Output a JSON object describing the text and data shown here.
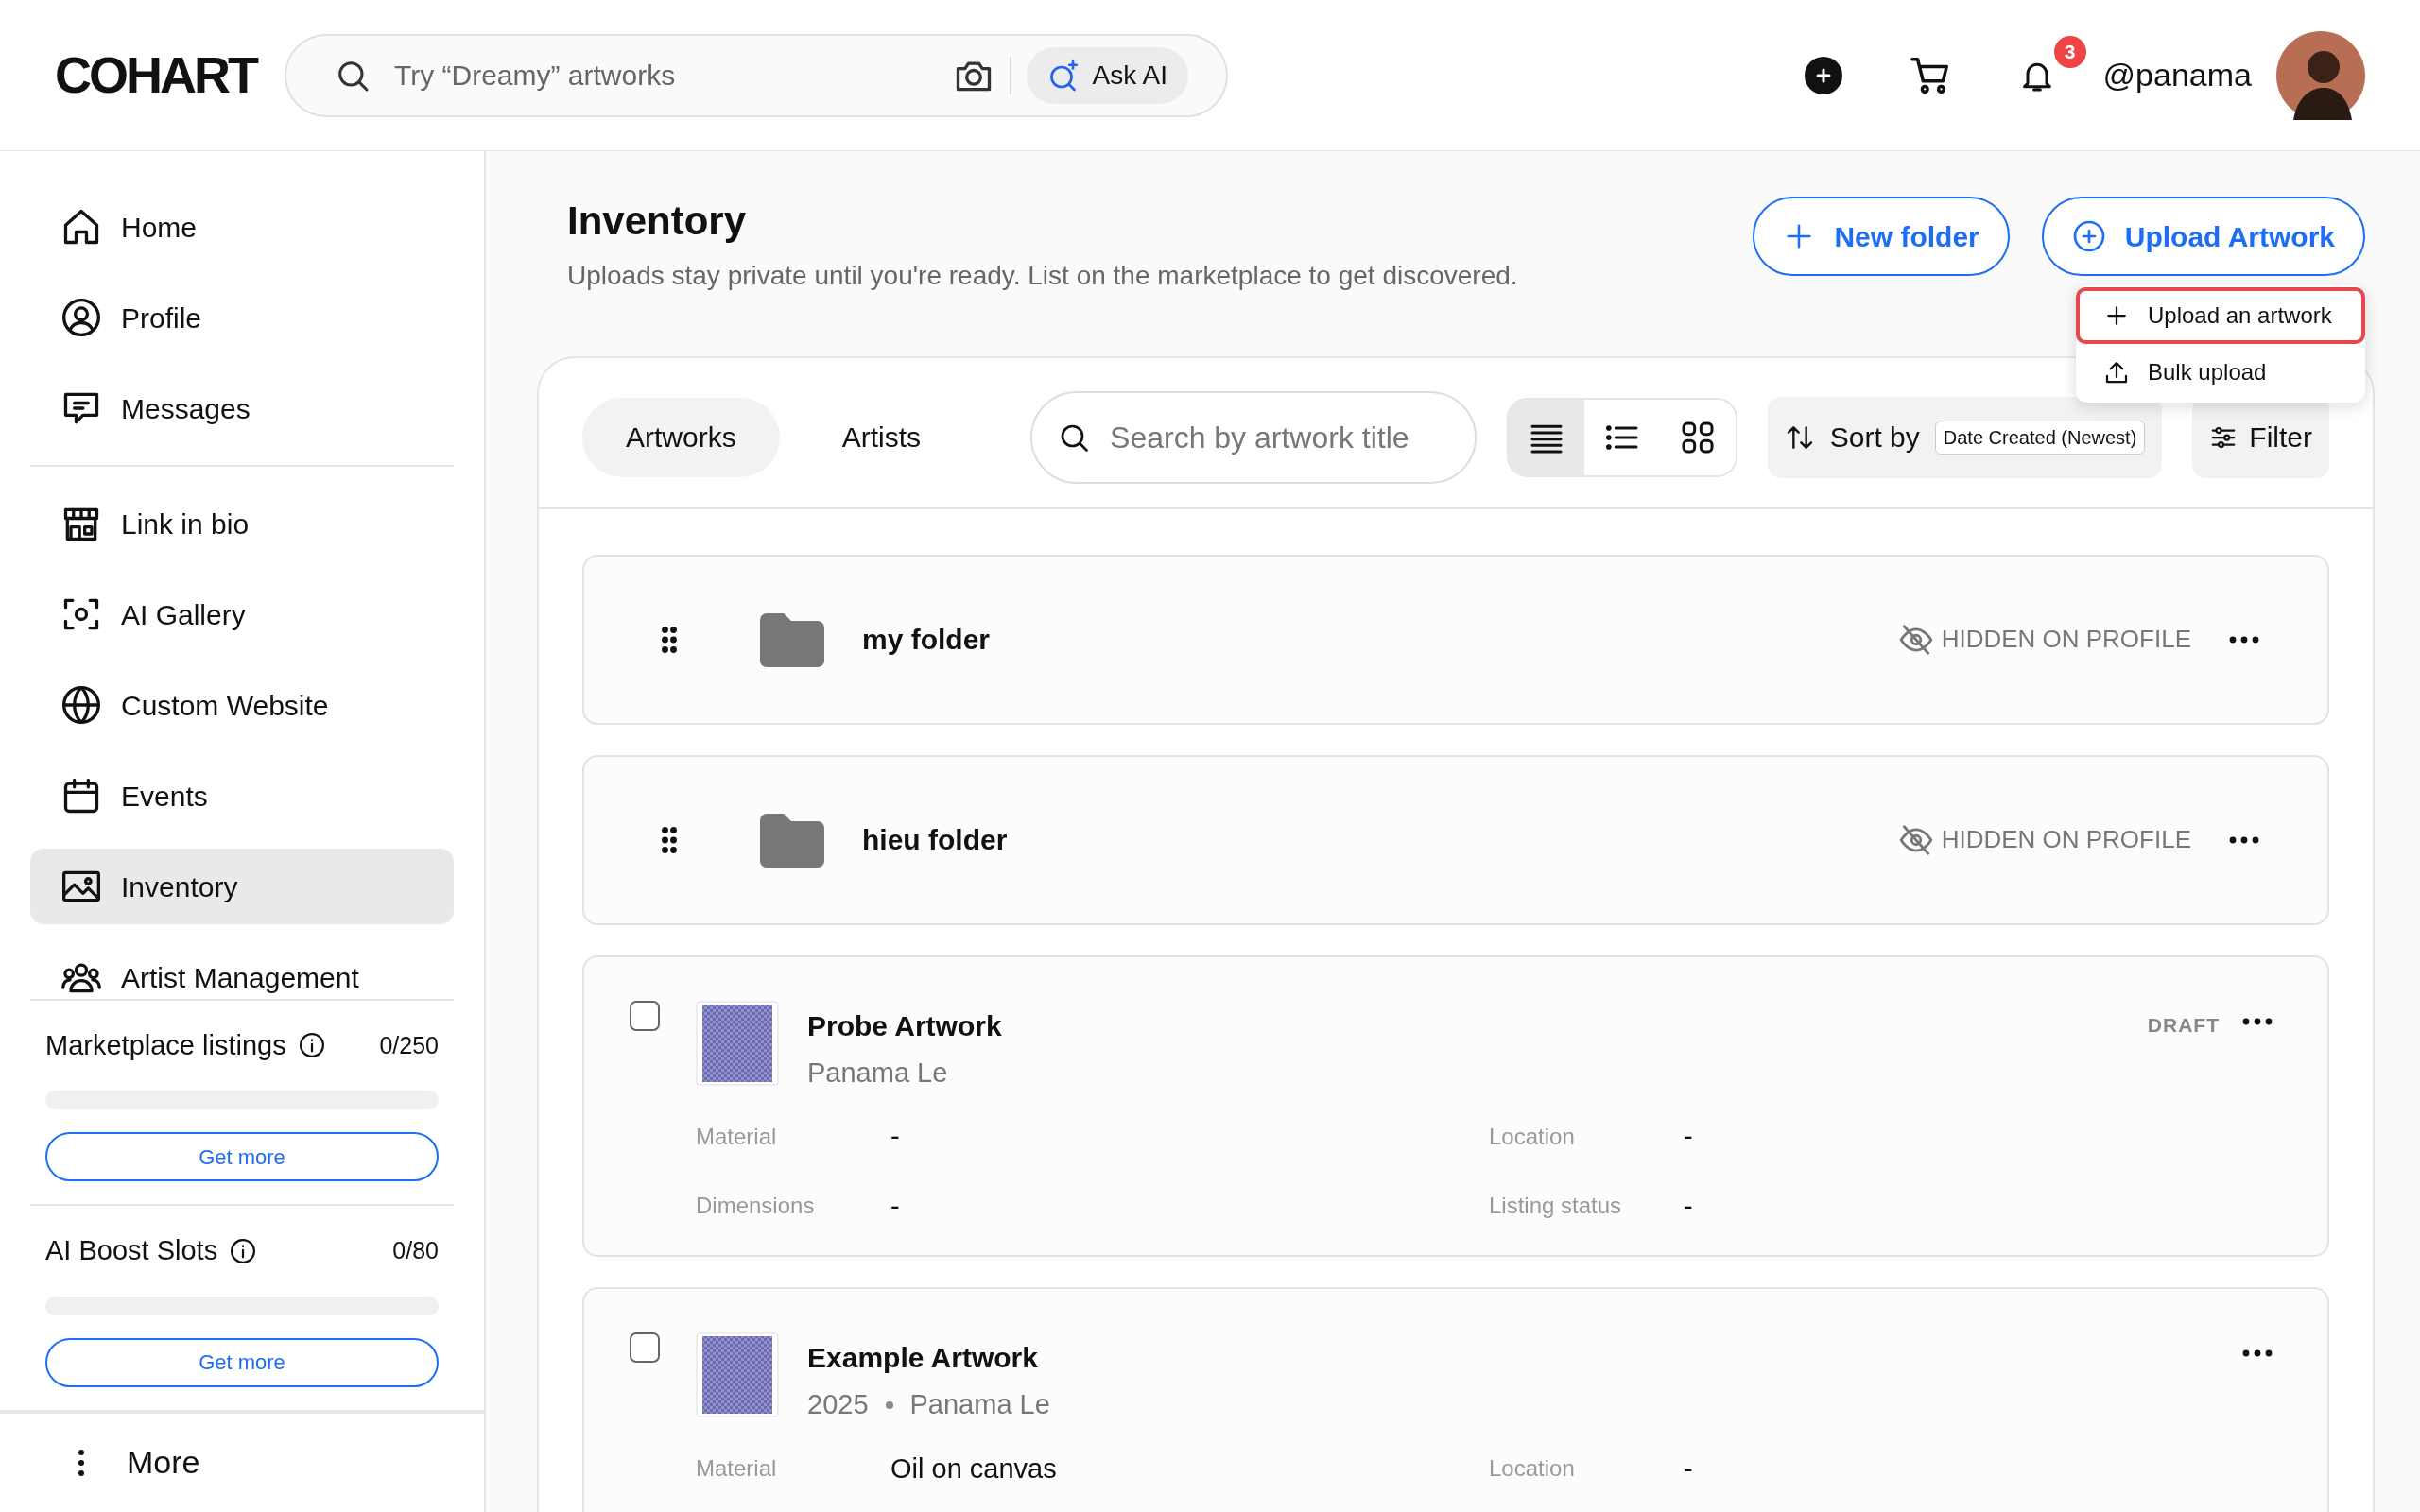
{
  "header": {
    "logo": "COHART",
    "search": {
      "placeholder": "Try “Dreamy” artworks"
    },
    "ask_ai": "Ask AI",
    "notification_count": "3",
    "username": "@panama"
  },
  "sidebar": {
    "groups": [
      [
        {
          "kind": "home",
          "label": "Home",
          "selected": false
        },
        {
          "kind": "profile",
          "label": "Profile",
          "selected": false
        },
        {
          "kind": "messages",
          "label": "Messages",
          "selected": false
        }
      ],
      [
        {
          "kind": "store",
          "label": "Link in bio",
          "selected": false
        },
        {
          "kind": "scan",
          "label": "AI Gallery",
          "selected": false
        },
        {
          "kind": "globe",
          "label": "Custom Website",
          "selected": false
        },
        {
          "kind": "calendar",
          "label": "Events",
          "selected": false
        },
        {
          "kind": "image",
          "label": "Inventory",
          "selected": true
        },
        {
          "kind": "people",
          "label": "Artist Management",
          "selected": false
        }
      ]
    ],
    "quotas": [
      {
        "label": "Marketplace listings",
        "count": "0/250",
        "level": 0,
        "button": "Get more"
      },
      {
        "label": "AI Boost Slots",
        "count": "0/80",
        "level": 0,
        "button": "Get more"
      }
    ],
    "more": "More"
  },
  "main": {
    "title": "Inventory",
    "subtitle": "Uploads stay private until you're ready. List on the marketplace to get discovered.",
    "buttons": [
      {
        "kind": "plus",
        "label": "New folder"
      },
      {
        "kind": "plus-circle",
        "label": "Upload Artwork"
      }
    ],
    "upload_menu": [
      {
        "kind": "plus",
        "label": "Upload an artwork",
        "highlighted": true
      },
      {
        "kind": "upload",
        "label": "Bulk upload",
        "highlighted": false
      }
    ],
    "tabs": [
      {
        "label": "Artworks",
        "selected": true
      },
      {
        "label": "Artists",
        "selected": false
      }
    ],
    "search": {
      "placeholder": "Search by artwork title"
    },
    "views": [
      {
        "kind": "rows",
        "selected": true
      },
      {
        "kind": "list",
        "selected": false
      },
      {
        "kind": "grid",
        "selected": false
      }
    ],
    "sort": {
      "label": "Sort by",
      "value": "Date Created (Newest)"
    },
    "filter": "Filter",
    "folders": [
      {
        "name": "my folder",
        "status": "HIDDEN ON PROFILE"
      },
      {
        "name": "hieu folder",
        "status": "HIDDEN ON PROFILE"
      }
    ],
    "artworks": [
      {
        "title": "Probe Artwork",
        "artist": "Panama Le",
        "status": "DRAFT",
        "checked": false,
        "fields": [
          {
            "label": "Material",
            "value": "-"
          },
          {
            "label": "Location",
            "value": "-"
          },
          {
            "label": "Dimensions",
            "value": "-"
          },
          {
            "label": "Listing status",
            "value": "-"
          }
        ]
      },
      {
        "title": "Example Artwork",
        "year": "2025",
        "artist": "Panama Le",
        "checked": false,
        "fields": [
          {
            "label": "Material",
            "value": "Oil on canvas"
          },
          {
            "label": "Location",
            "value": "-"
          }
        ]
      }
    ]
  }
}
